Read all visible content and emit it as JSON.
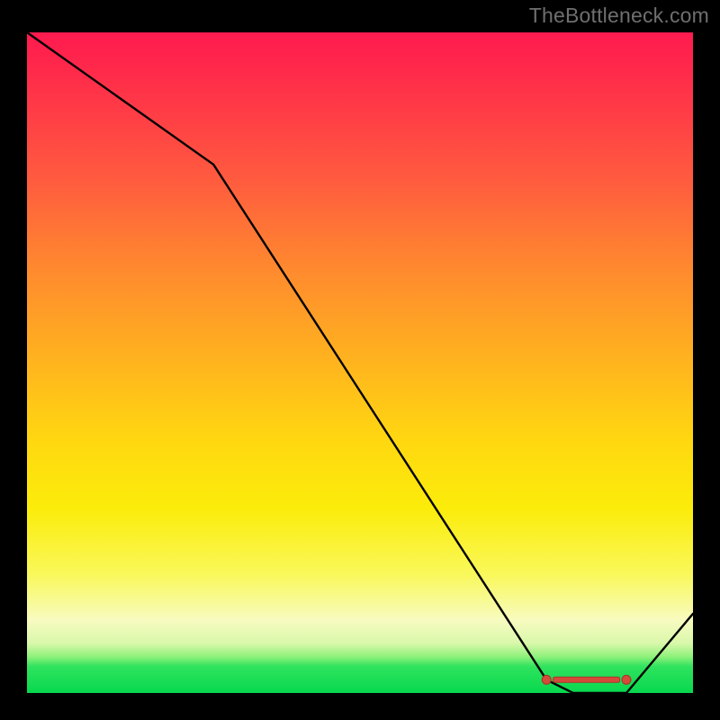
{
  "attribution": "TheBottleneck.com",
  "colors": {
    "gradient_top": "#ff1a4f",
    "gradient_mid_orange": "#ff8a2e",
    "gradient_mid_yellow": "#ffd810",
    "gradient_pale": "#f8fbc0",
    "gradient_green": "#07d84e",
    "curve": "#000000",
    "marker": "#d64a3a",
    "background": "#000000"
  },
  "chart_data": {
    "type": "line",
    "title": "",
    "xlabel": "",
    "ylabel": "",
    "xlim": [
      0,
      100
    ],
    "ylim": [
      0,
      100
    ],
    "grid": false,
    "legend": null,
    "series": [
      {
        "name": "curve",
        "x": [
          0,
          28,
          78,
          82,
          90,
          100
        ],
        "values": [
          100,
          80,
          2,
          0,
          0,
          12
        ]
      }
    ],
    "markers": {
      "left_dot": {
        "x": 78,
        "y": 2
      },
      "right_dot": {
        "x": 90,
        "y": 2
      },
      "bar": {
        "x0": 79,
        "x1": 89,
        "y": 2
      }
    },
    "notes": "x and y are percent of plot width/height; y=0 is bottom. Curve descends from top-left, breaks slope near x≈28, reaches minimum on a short flat segment x≈78–90, then rises toward the right edge."
  }
}
